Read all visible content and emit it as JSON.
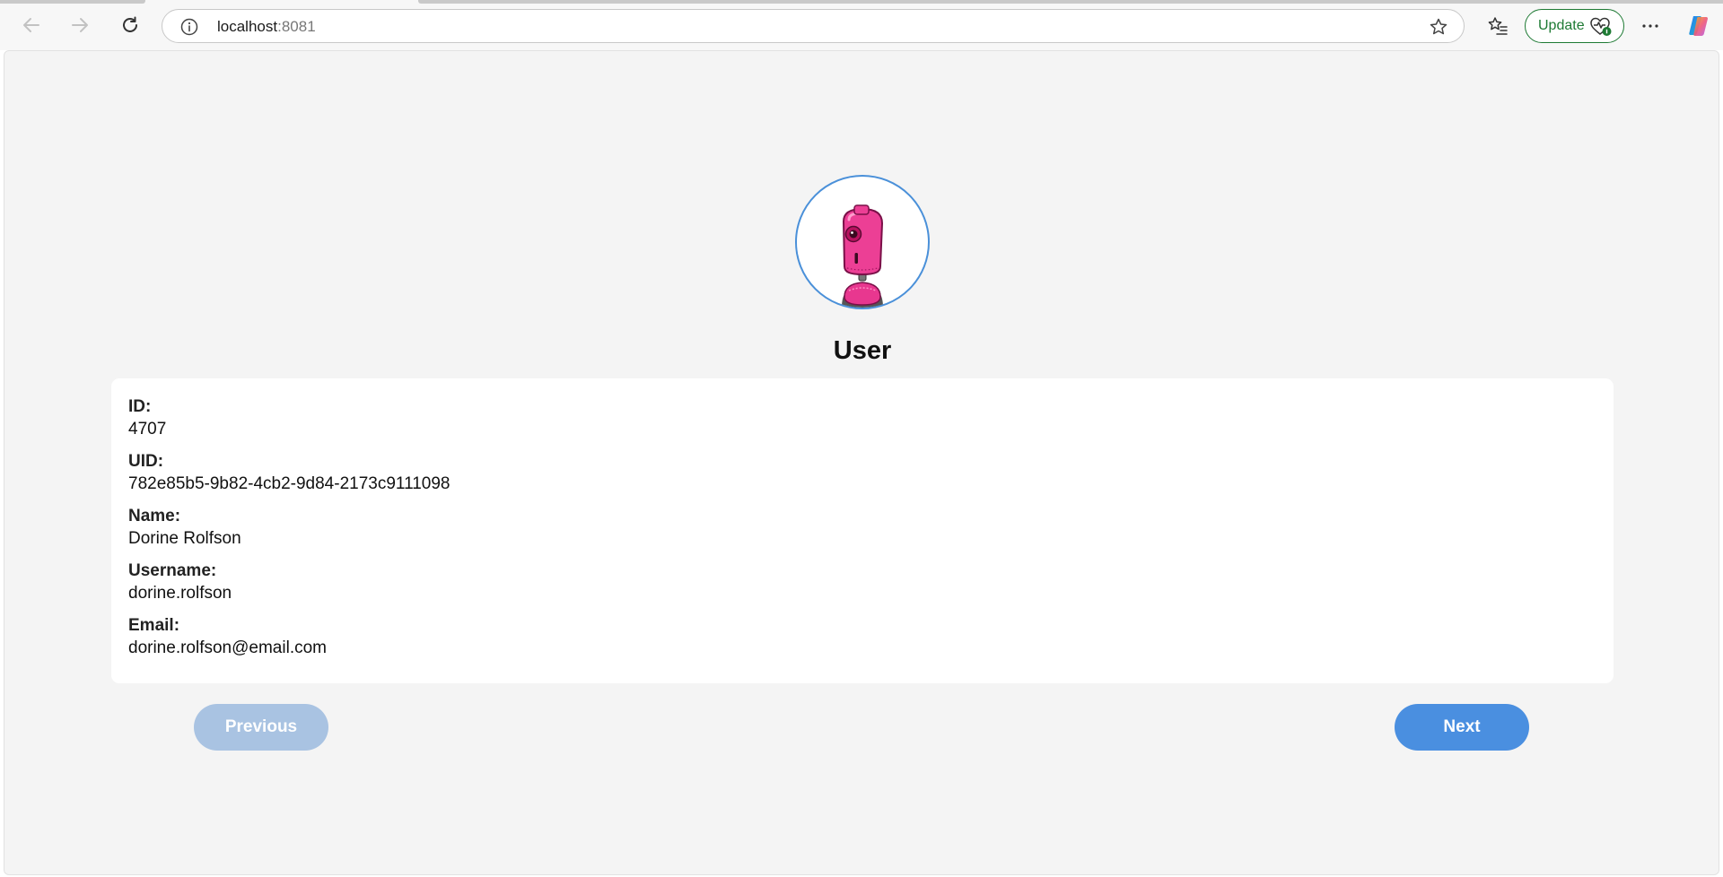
{
  "browser": {
    "url_host": "localhost",
    "url_port": ":8081",
    "update_label": "Update",
    "icons": {
      "back": "back-arrow-icon",
      "forward": "forward-arrow-icon",
      "reload": "reload-icon",
      "site_info": "info-icon",
      "favorite": "star-icon",
      "favorites_list": "favorites-icon",
      "health": "health-icon",
      "more": "more-icon",
      "copilot": "copilot-icon"
    },
    "colors": {
      "update_accent": "#1e7a34"
    }
  },
  "page": {
    "title": "User",
    "avatar_icon": "robot-avatar-icon",
    "fields": [
      {
        "label": "ID:",
        "value": "4707"
      },
      {
        "label": "UID:",
        "value": "782e85b5-9b82-4cb2-9d84-2173c9111098"
      },
      {
        "label": "Name:",
        "value": "Dorine Rolfson"
      },
      {
        "label": "Username:",
        "value": "dorine.rolfson"
      },
      {
        "label": "Email:",
        "value": "dorine.rolfson@email.com"
      }
    ],
    "buttons": {
      "previous": "Previous",
      "next": "Next"
    },
    "colors": {
      "background": "#f4f4f4",
      "accent": "#4a8fe0",
      "avatar_border": "#4a90d9",
      "disabled_button": "#a9c3e2"
    }
  }
}
